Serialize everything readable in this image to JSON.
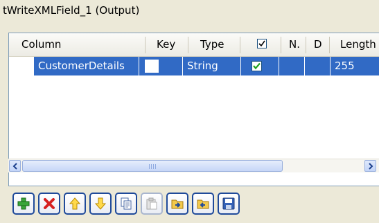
{
  "window": {
    "title": "tWriteXMLField_1 (Output)"
  },
  "table": {
    "columns": [
      {
        "key": "column",
        "label": "Column"
      },
      {
        "key": "key",
        "label": "Key"
      },
      {
        "key": "type",
        "label": "Type"
      },
      {
        "key": "nullable",
        "label": "",
        "icon": "checkbox-checked-icon"
      },
      {
        "key": "n",
        "label": "N."
      },
      {
        "key": "d",
        "label": "D"
      },
      {
        "key": "length",
        "label": "Length"
      }
    ],
    "rows": [
      {
        "column": "CustomerDetails",
        "key": false,
        "type": "String",
        "nullable": true,
        "n": "",
        "d": "",
        "length": "255"
      }
    ],
    "selection_color": "#316ac5"
  },
  "scrollbar": {
    "left_icon": "arrow-left-icon",
    "right_icon": "arrow-right-icon",
    "grip_icon": "scroll-grip-icon"
  },
  "toolbar": {
    "buttons": [
      {
        "name": "add-button",
        "icon": "plus-icon",
        "enabled": true
      },
      {
        "name": "remove-button",
        "icon": "red-x-icon",
        "enabled": true
      },
      {
        "name": "move-up-button",
        "icon": "arrow-up-icon",
        "enabled": true
      },
      {
        "name": "move-down-button",
        "icon": "arrow-down-icon",
        "enabled": true
      },
      {
        "name": "copy-button",
        "icon": "copy-icon",
        "enabled": true
      },
      {
        "name": "paste-button",
        "icon": "paste-icon",
        "enabled": false
      },
      {
        "name": "import-button",
        "icon": "import-schema-icon",
        "enabled": true
      },
      {
        "name": "export-button",
        "icon": "export-schema-icon",
        "enabled": true
      },
      {
        "name": "save-button",
        "icon": "floppy-disk-icon",
        "enabled": true
      }
    ]
  }
}
